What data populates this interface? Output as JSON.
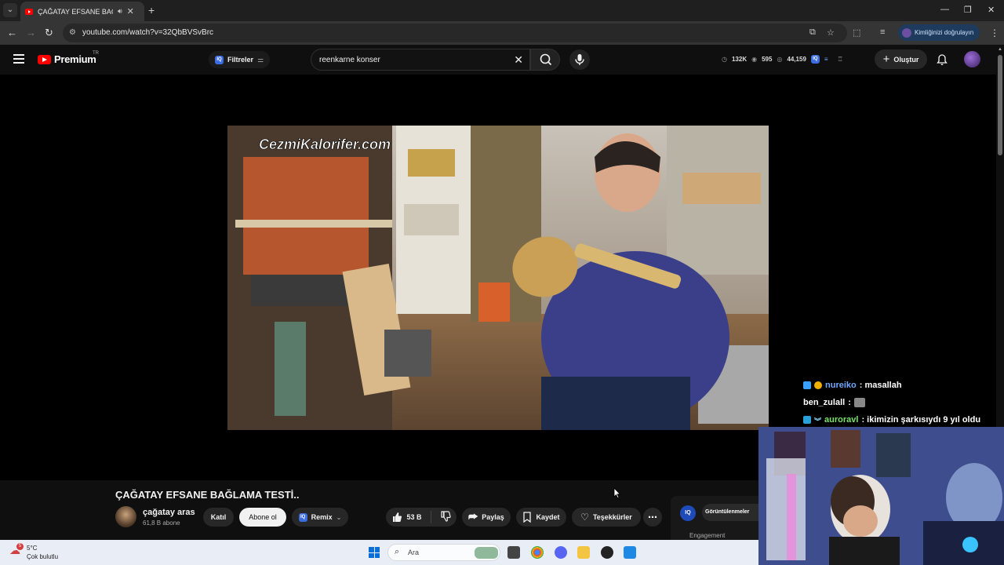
{
  "browser": {
    "tab_title": "ÇAĞATAY EFSANE BAĞLAMA",
    "new_tab_icon": "+",
    "url": "youtube.com/watch?v=32QbBVSvBrc",
    "profile_label": "Kimliğinizi doğrulayın"
  },
  "youtube": {
    "logo_text": "Premium",
    "country_code": "TR",
    "filters_label": "Filtreler",
    "search_query": "reenkarne konser",
    "stats": {
      "views": "132K",
      "watching": "595",
      "count": "44,159"
    },
    "create_label": "Oluştur"
  },
  "chat": [
    {
      "user": "nureiko",
      "user_color": "#6fa8ff",
      "message": ": masallah"
    },
    {
      "user": "ben_zulall",
      "user_color": "#ffffff",
      "message": ":"
    },
    {
      "user": "auroravl",
      "user_color": "#7be36b",
      "message": ": ikimizin şarkısıydı 9 yıl oldu"
    }
  ],
  "video": {
    "title": "ÇAĞATAY EFSANE BAĞLAMA TESTİ..",
    "watermark": "CezmiKalorifer.com",
    "channel_name": "çağatay aras",
    "subscribers": "61,8 B abone",
    "join_label": "Katıl",
    "subscribe_label": "Abone ol",
    "remix_label": "Remix",
    "likes": "53 B",
    "share_label": "Paylaş",
    "save_label": "Kaydet",
    "thanks_label": "Teşekkürler"
  },
  "side_panel": {
    "views_tab": "Görüntülenmeler",
    "engagement": "Engagement"
  },
  "taskbar": {
    "weather_badge": "5",
    "temperature": "5°C",
    "weather_desc": "Çok bulutlu",
    "search_placeholder": "Ara"
  },
  "colors": {
    "youtube_red": "#ff0000",
    "iq_blue": "#3b6de0",
    "background": "#0f0f0f"
  }
}
